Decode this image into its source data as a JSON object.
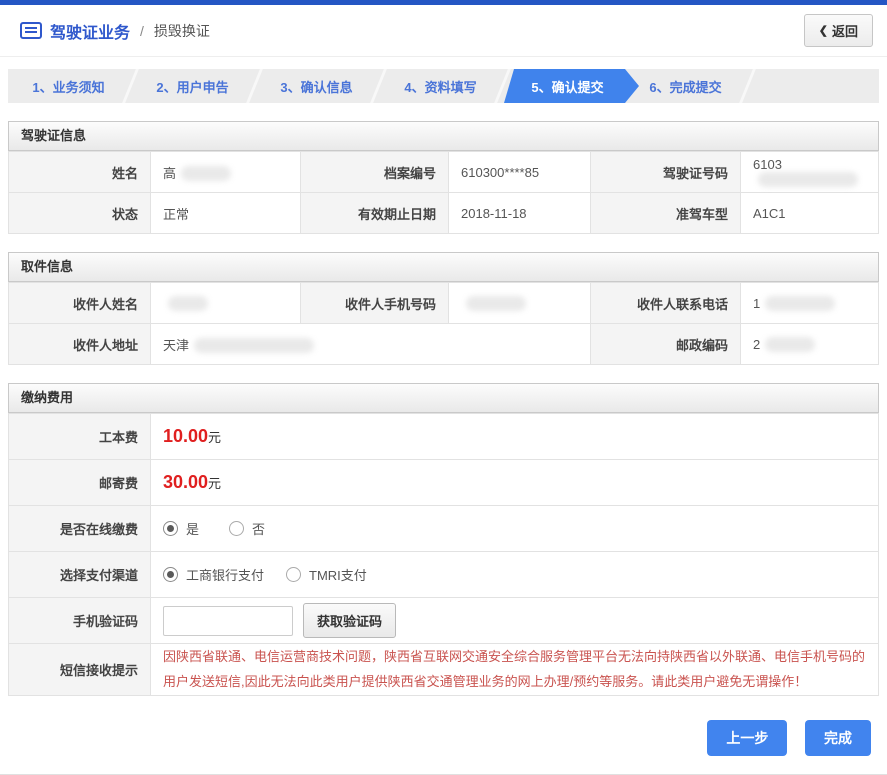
{
  "colors": {
    "top_bar_blue": "#2456c4",
    "title_blue": "#2f58cc",
    "step_text_blue": "#4a74d8",
    "active_step_blue": "#4083ec",
    "button_blue": "#4184ee",
    "fee_red": "#e01f1f",
    "notice_red": "#c9534f"
  },
  "header": {
    "icon": "menu-list-icon",
    "title": "驾驶证业务",
    "divider": "/",
    "subtitle": "损毁换证",
    "back_icon": "❮",
    "back_label": "返回"
  },
  "steps": {
    "active_index": 4,
    "items": [
      {
        "label": "1、业务须知"
      },
      {
        "label": "2、用户申告"
      },
      {
        "label": "3、确认信息"
      },
      {
        "label": "4、资料填写"
      },
      {
        "label": "5、确认提交"
      },
      {
        "label": "6、完成提交"
      }
    ]
  },
  "license_info": {
    "section_title": "驾驶证信息",
    "rows": [
      [
        {
          "label": "姓名",
          "value": "高",
          "masked": true
        },
        {
          "label": "档案编号",
          "value": "610300****85",
          "masked": false
        },
        {
          "label": "驾驶证号码",
          "value": "6103",
          "masked": true
        }
      ],
      [
        {
          "label": "状态",
          "value": "正常",
          "masked": false
        },
        {
          "label": "有效期止日期",
          "value": "2018-11-18",
          "masked": false
        },
        {
          "label": "准驾车型",
          "value": "A1C1",
          "masked": false
        }
      ]
    ]
  },
  "pickup_info": {
    "section_title": "取件信息",
    "row1": [
      {
        "label": "收件人姓名",
        "value": "",
        "masked": true
      },
      {
        "label": "收件人手机号码",
        "value": "",
        "masked": true
      },
      {
        "label": "收件人联系电话",
        "value": "1",
        "masked": true
      }
    ],
    "row2": {
      "address": {
        "label": "收件人地址",
        "value": "天津",
        "masked": true
      },
      "postcode": {
        "label": "邮政编码",
        "value": "2",
        "masked": true
      }
    }
  },
  "payment": {
    "section_title": "缴纳费用",
    "work_fee": {
      "label": "工本费",
      "amount": "10.00",
      "unit": "元"
    },
    "post_fee": {
      "label": "邮寄费",
      "amount": "30.00",
      "unit": "元"
    },
    "online_pay": {
      "label": "是否在线缴费",
      "options": [
        {
          "label": "是",
          "checked": true
        },
        {
          "label": "否",
          "checked": false
        }
      ]
    },
    "pay_channel": {
      "label": "选择支付渠道",
      "options": [
        {
          "label": "工商银行支付",
          "checked": true
        },
        {
          "label": "TMRI支付",
          "checked": false
        }
      ]
    },
    "sms_code": {
      "label": "手机验证码",
      "input_value": "",
      "button_label": "获取验证码"
    },
    "sms_notice": {
      "label": "短信接收提示",
      "text": "因陕西省联通、电信运营商技术问题，陕西省互联网交通安全综合服务管理平台无法向持陕西省以外联通、电信手机号码的用户发送短信,因此无法向此类用户提供陕西省交通管理业务的网上办理/预约等服务。请此类用户避免无谓操作！"
    }
  },
  "footer": {
    "prev_button": "上一步",
    "finish_button": "完成"
  }
}
